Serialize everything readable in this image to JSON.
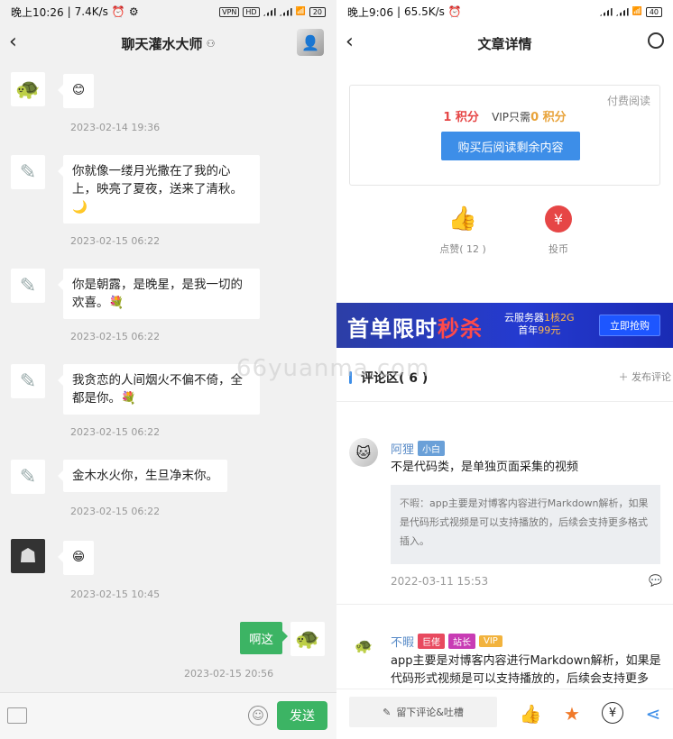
{
  "left": {
    "status": {
      "time": "晚上10:26",
      "speed": "7.4K/s",
      "battery": "20"
    },
    "title": "聊天灌水大师",
    "messages": [
      {
        "text": "😊",
        "time": "2023-02-14 19:36"
      },
      {
        "text": "你就像一缕月光撒在了我的心上，映亮了夏夜，送来了清秋。🌙",
        "time": "2023-02-15 06:22"
      },
      {
        "text": "你是朝露，是晚星，是我一切的欢喜。💐",
        "time": "2023-02-15 06:22"
      },
      {
        "text": "我贪恋的人间烟火不偏不倚，全都是你。💐",
        "time": "2023-02-15 06:22"
      },
      {
        "text": "金木水火你，生旦净末你。",
        "time": "2023-02-15 06:22"
      },
      {
        "text": "😁",
        "time": "2023-02-15 10:45"
      }
    ],
    "my_message": {
      "text": "啊这",
      "time": "2023-02-15 20:56"
    },
    "send_label": "发送",
    "icons": {
      "back": "back-arrow-icon",
      "image": "image-icon",
      "emoji": "emoji-icon"
    }
  },
  "right": {
    "status": {
      "time": "晚上9:06",
      "speed": "65.5K/s",
      "battery": "40"
    },
    "title": "文章详情",
    "pay": {
      "note": "付费阅读",
      "price": "1 积分",
      "vip_prefix": "VIP只需",
      "vip_price": "0 积分",
      "button": "购买后阅读剩余内容"
    },
    "like_label": "点赞( 12 )",
    "coin_label": "投币",
    "banner": {
      "big1": "首单限时",
      "big2": "秒杀",
      "line1a": "云服务器",
      "line1b": "1核2G",
      "line2a": "首年",
      "line2b": "99元",
      "cta": "立即抢购"
    },
    "comment_header": "评论区( 6 )",
    "post_comment": "发布评论",
    "comments": [
      {
        "name": "阿狸",
        "tags": [
          {
            "label": "小白",
            "color": "#6aa0d8"
          }
        ],
        "text": "不是代码类，是单独页面采集的视频",
        "reply": {
          "who": "不暇：",
          "text": "app主要是对博客内容进行Markdown解析，如果是代码形式视频是可以支持播放的，后续会支持更多格式插入。"
        },
        "date": "2022-03-11 15:53"
      },
      {
        "name": "不暇",
        "tags": [
          {
            "label": "巨佬",
            "color": "#e84a5f"
          },
          {
            "label": "站长",
            "color": "#c83cb4"
          },
          {
            "label": "VIP",
            "color": "#f2b33d"
          }
        ],
        "text": "app主要是对博客内容进行Markdown解析，如果是代码形式视频是可以支持播放的，后续会支持更多"
      }
    ],
    "leave_comment": "留下评论&吐槽",
    "watermark": "66yuanma.com"
  }
}
